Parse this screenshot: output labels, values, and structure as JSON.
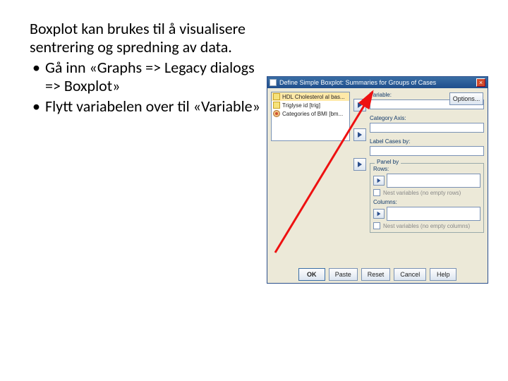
{
  "text": {
    "intro": "Boxplot kan brukes til å visualisere sentrering og spredning av data.",
    "bullets": [
      "Gå inn «Graphs => Legacy dialogs => Boxplot»",
      "Flytt variabelen over til «Variable»"
    ]
  },
  "dialog": {
    "title": "Define Simple Boxplot: Summaries for Groups of Cases",
    "options_label": "Options...",
    "var_items": [
      "HDL Cholesterol al bas...",
      "Triglyse id [trig]",
      "Categories of BMI [bm..."
    ],
    "labels": {
      "variable": "Variable:",
      "category": "Category Axis:",
      "label_cases": "Label Cases by:",
      "panel": "Panel by",
      "rows": "Rows:",
      "columns": "Columns:",
      "nest_rows": "Nest variables (no empty rows)",
      "nest_cols": "Nest variables (no empty columns)"
    },
    "buttons": {
      "ok": "OK",
      "paste": "Paste",
      "reset": "Reset",
      "cancel": "Cancel",
      "help": "Help"
    }
  }
}
